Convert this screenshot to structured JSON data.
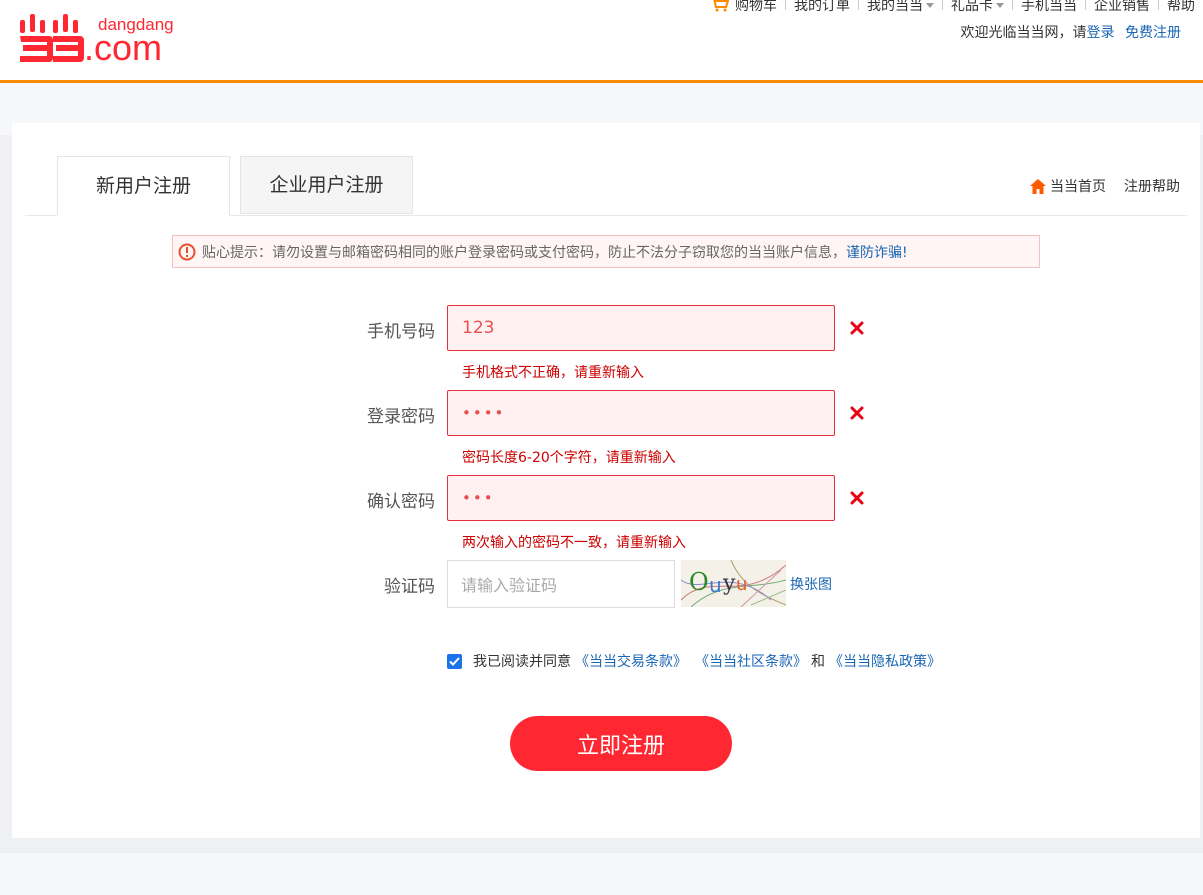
{
  "brand": {
    "logo_text": "dangdang.com",
    "accent": "#ff2832",
    "header_line": "#ff8a00"
  },
  "topnav": {
    "items": [
      {
        "label": "购物车",
        "icon": "cart-icon"
      },
      {
        "label": "我的订单"
      },
      {
        "label": "我的当当",
        "dropdown": true
      },
      {
        "label": "礼品卡",
        "dropdown": true
      },
      {
        "label": "手机当当"
      },
      {
        "label": "企业销售"
      },
      {
        "label": "帮助"
      }
    ],
    "welcome": "欢迎光临当当网，请",
    "login": "登录",
    "register": "免费注册"
  },
  "tabs": [
    {
      "label": "新用户注册",
      "active": true
    },
    {
      "label": "企业用户注册",
      "active": false
    }
  ],
  "quick_links": {
    "home": "当当首页",
    "help": "注册帮助"
  },
  "tip": {
    "text": "贴心提示：请勿设置与邮箱密码相同的账户登录密码或支付密码，防止不法分子窃取您的当当账户信息，",
    "link": "谨防诈骗!"
  },
  "form": {
    "phone": {
      "label": "手机号码",
      "value": "123",
      "error": "手机格式不正确，请重新输入"
    },
    "password": {
      "label": "登录密码",
      "value": "••••",
      "error": "密码长度6-20个字符，请重新输入"
    },
    "confirm": {
      "label": "确认密码",
      "value": "•••",
      "error": "两次输入的密码不一致，请重新输入"
    },
    "captcha": {
      "label": "验证码",
      "placeholder": "请输入验证码",
      "image_text": "Ouyu",
      "refresh": "换张图"
    }
  },
  "agreement": {
    "checked": true,
    "text": "我已阅读并同意",
    "terms1": "《当当交易条款》",
    "terms2": "《当当社区条款》",
    "and": "和",
    "terms3": "《当当隐私政策》"
  },
  "submit_label": "立即注册"
}
